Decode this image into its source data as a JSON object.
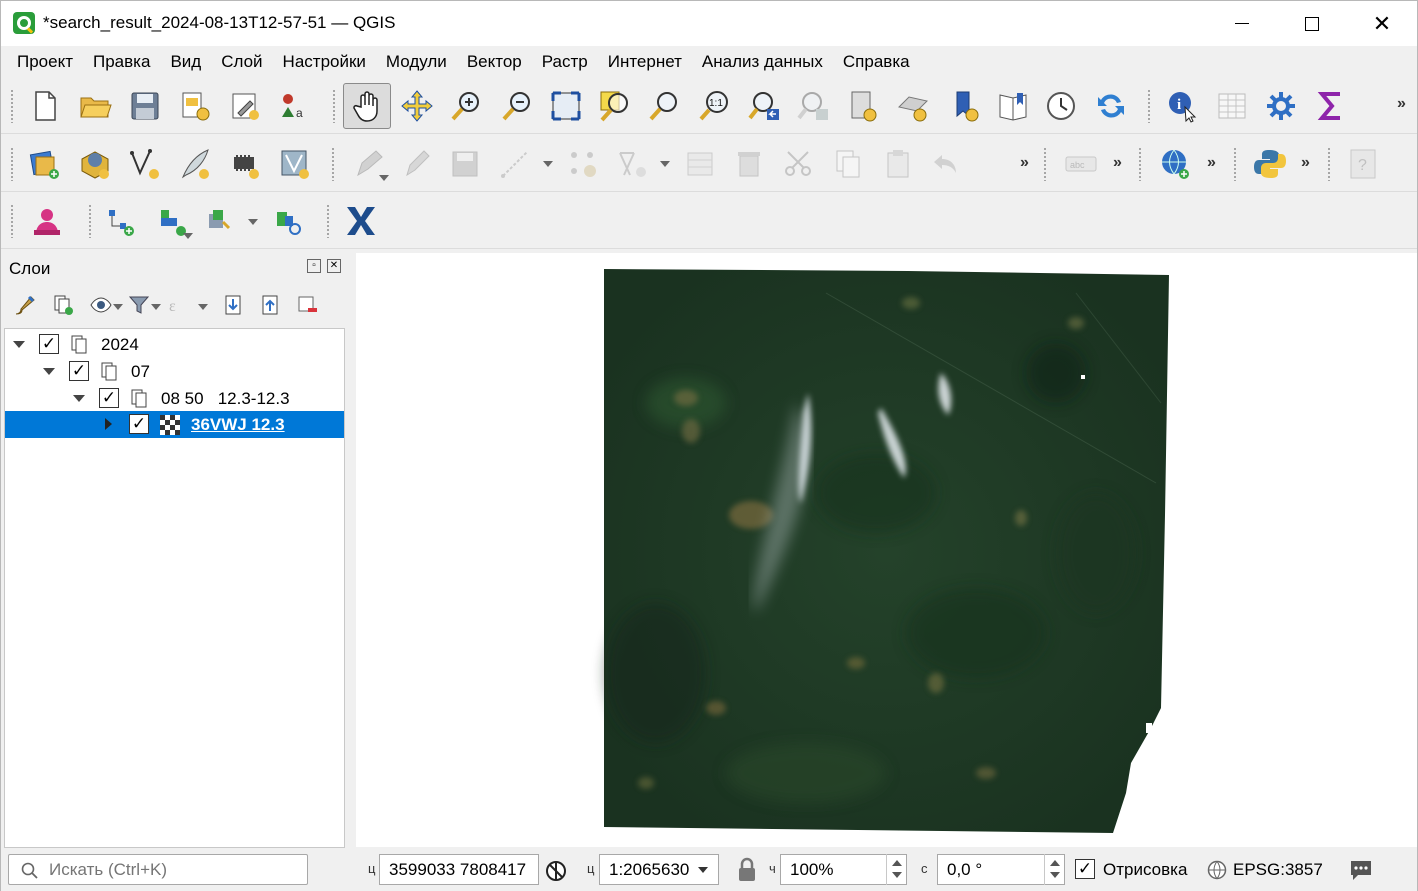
{
  "window": {
    "title": "*search_result_2024-08-13T12-57-51 — QGIS",
    "minimize": "",
    "maximize": "",
    "close": "✕"
  },
  "menu": [
    "Проект",
    "Правка",
    "Вид",
    "Слой",
    "Настройки",
    "Модули",
    "Вектор",
    "Растр",
    "Интернет",
    "Анализ данных",
    "Справка"
  ],
  "toolbar_overflow": "»",
  "layers_panel": {
    "title": "Слои",
    "tree": [
      {
        "label": "2024",
        "checked": true,
        "expanded": true,
        "level": 0
      },
      {
        "label": "07",
        "checked": true,
        "expanded": true,
        "level": 1
      },
      {
        "label": "08 50   12.3-12.3",
        "checked": true,
        "expanded": true,
        "level": 2
      },
      {
        "label": "36VWJ 12.3",
        "checked": true,
        "expanded": false,
        "level": 3,
        "selected": true
      }
    ]
  },
  "statusbar": {
    "search_placeholder": "Искать (Ctrl+K)",
    "coord_label": "ц",
    "coordinates": "3599033  7808417",
    "scale_label": "ц",
    "scale": "1:2065630",
    "magnifier_label": "ч",
    "magnifier": "100%",
    "rotation_label": "с",
    "rotation": "0,0 °",
    "render_label": "Отрисовка",
    "render_checked": true,
    "crs": "EPSG:3857"
  },
  "check_mark": "✓",
  "colors": {
    "selection": "#0078d7",
    "map_background": "#ffffff",
    "raster_base": "#1f3a22"
  }
}
